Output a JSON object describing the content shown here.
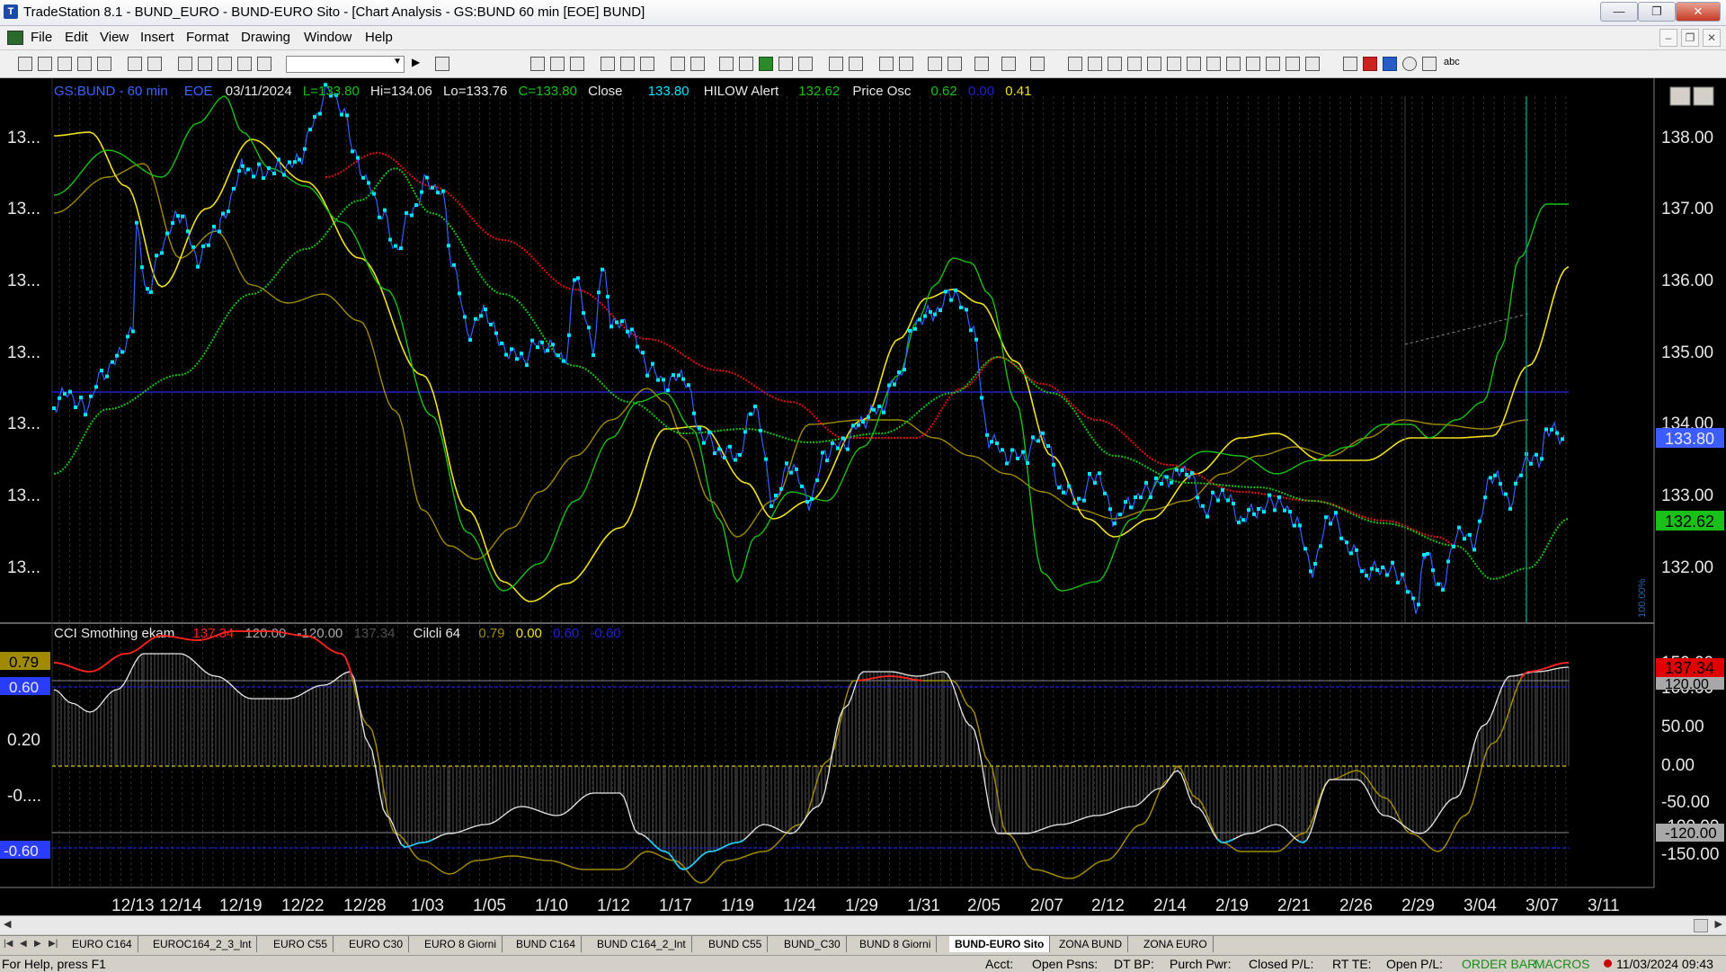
{
  "window": {
    "title": "TradeStation 8.1 - BUND_EURO - BUND-EURO Sito - [Chart Analysis - GS:BUND  60 min  [EOE] BUND]",
    "min": "—",
    "max": "❐",
    "close": "✕"
  },
  "menu": [
    "File",
    "Edit",
    "View",
    "Insert",
    "Format",
    "Drawing",
    "Window",
    "Help"
  ],
  "price_header": {
    "symbol": "GS:BUND - 60 min",
    "session": "EOE",
    "date": "03/11/2024",
    "last": "L=133.80",
    "high": "Hi=134.06",
    "low": "Lo=133.76",
    "close_val": "C=133.80",
    "close_label": "Close",
    "close_num": "133.80",
    "hilow_label": "HILOW Alert",
    "hilow_val": "132.62",
    "osc_label": "Price Osc",
    "osc1": "0.62",
    "osc2": "0.00",
    "osc3": "0.41"
  },
  "osc_header": {
    "cci_label": "CCI Smothing ekam",
    "cci_val": "137.34",
    "upper": "120.00",
    "lower": "-120.00",
    "faded": "137.34",
    "cicli_label": "Cilcli 64",
    "c1": "0.79",
    "c2": "0.00",
    "c3": "0.60",
    "c4": "-0.60"
  },
  "price_axis": {
    "right": [
      "138.00",
      "137.00",
      "136.00",
      "135.00",
      "134.00",
      "133.00",
      "132.00"
    ],
    "left": [
      "13...",
      "13...",
      "13...",
      "13...",
      "13...",
      "13...",
      "13..."
    ],
    "last_tag": "133.80",
    "alert_tag": "132.62",
    "scale_label": "100.00%"
  },
  "osc_axis": {
    "right": [
      "150.00",
      "100.00",
      "50.00",
      "0.00",
      "-50.00",
      "-100.00",
      "-150.00"
    ],
    "left": [
      "0.20",
      "-0...."
    ],
    "tag_79": "0.79",
    "tag_60": "0.60",
    "tag_m60": "-0.60",
    "tag_cci": "137.34",
    "tag_120": "120.00",
    "tag_m120": "-120.00"
  },
  "x_axis": [
    "12/13",
    "12/14",
    "12/19",
    "12/22",
    "12/28",
    "1/03",
    "1/05",
    "1/10",
    "1/12",
    "1/17",
    "1/19",
    "1/24",
    "1/29",
    "1/31",
    "2/05",
    "2/07",
    "2/12",
    "2/14",
    "2/19",
    "2/21",
    "2/26",
    "2/29",
    "3/04",
    "3/07",
    "3/11"
  ],
  "sheet_tabs": [
    "EURO C164",
    "EUROC164_2_3_lnt",
    "EURO C55",
    "EURO C30",
    "EURO 8 Giorni",
    "BUND C164",
    "BUND C164_2_lnt",
    "BUND C55",
    "BUND_C30",
    "BUND 8 Giorni",
    "BUND-EURO Sito",
    "ZONA BUND",
    "ZONA EURO"
  ],
  "active_tab": "BUND-EURO Sito",
  "status": {
    "help": "For Help, press F1",
    "acct": "Acct:",
    "open_psns": "Open Psns:",
    "dt_bp": "DT BP:",
    "purch_pwr": "Purch Pwr:",
    "closed_pl": "Closed P/L:",
    "rt_te": "RT TE:",
    "open_pl": "Open P/L:",
    "order": "ORDER BAR",
    "macros": "MACROS",
    "datetime": "11/03/2024 09:43"
  },
  "colors": {
    "price": "#00e5ff",
    "red_ma": "#e01010",
    "green_ma": "#18c018",
    "yellow": "#f0e020",
    "olive": "#a08a00",
    "blue_line": "#2020d0",
    "osc_white": "#e8e8e8",
    "cci_red": "#ff2020"
  }
}
